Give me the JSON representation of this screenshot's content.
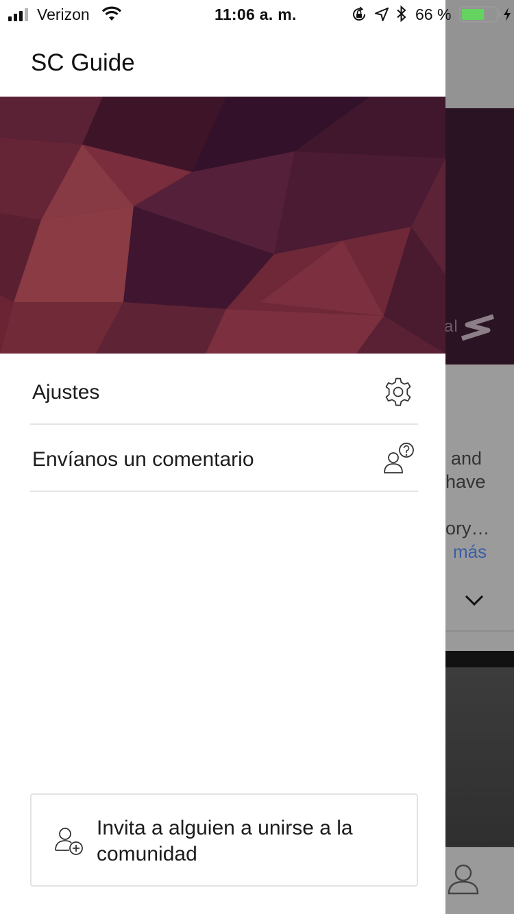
{
  "status_bar": {
    "carrier": "Verizon",
    "time": "11:06 a. m.",
    "battery_percent": "66 %",
    "battery_level": 0.66
  },
  "drawer": {
    "title": "SC Guide",
    "menu_items": [
      {
        "label": "Ajustes",
        "icon": "gear-icon"
      },
      {
        "label": "Envíanos un comentario",
        "icon": "feedback-person-question-icon"
      }
    ],
    "invite": {
      "label": "Invita a alguien a unirse a la comunidad",
      "icon": "add-person-icon"
    }
  },
  "background_app": {
    "partial_text_lines": [
      "and",
      "have",
      "ory…"
    ],
    "more_link": "más",
    "logo_partial": "al",
    "logo_partial_2": "s"
  },
  "colors": {
    "drawer_bg": "#ffffff",
    "hero_base": "#4a1a2e",
    "link_blue": "#3b5ea6",
    "divider": "#e4e4e4"
  }
}
